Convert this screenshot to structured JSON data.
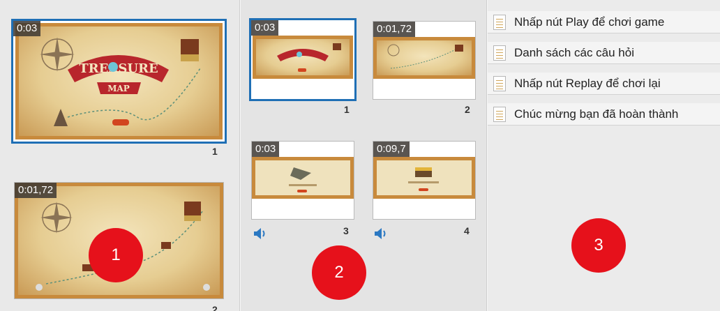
{
  "panel1": {
    "slides": [
      {
        "duration": "0:03",
        "number": "1",
        "selected": true
      },
      {
        "duration": "0:01,72",
        "number": "2",
        "selected": false
      }
    ],
    "badge": "1"
  },
  "panel2": {
    "slides": [
      {
        "duration": "0:03",
        "number": "1",
        "selected": true,
        "audio": false
      },
      {
        "duration": "0:01,72",
        "number": "2",
        "selected": false,
        "audio": false
      },
      {
        "duration": "0:03",
        "number": "3",
        "selected": false,
        "audio": true
      },
      {
        "duration": "0:09,7",
        "number": "4",
        "selected": false,
        "audio": true
      }
    ],
    "badge": "2"
  },
  "panel3": {
    "outline": [
      {
        "label": "Nhấp nút Play để chơi game"
      },
      {
        "label": "Danh sách các câu hỏi"
      },
      {
        "label": "Nhấp nút Replay để chơi lại"
      },
      {
        "label": "Chúc mừng bạn đã hoàn thành"
      }
    ],
    "badge": "3"
  },
  "colors": {
    "selection": "#1f6fb5",
    "badge": "#e6111b",
    "frame": "#c88a3c",
    "parchment": "#ecd8a6"
  },
  "icons": [
    "speaker-icon",
    "document-icon"
  ]
}
